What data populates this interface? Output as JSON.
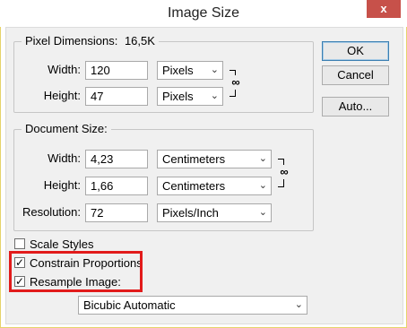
{
  "window": {
    "title": "Image Size",
    "close_glyph": "x"
  },
  "buttons": {
    "ok": "OK",
    "cancel": "Cancel",
    "auto": "Auto..."
  },
  "pixel_dimensions": {
    "legend": "Pixel Dimensions:",
    "size": "16,5K",
    "width": {
      "label": "Width:",
      "value": "120",
      "unit": "Pixels"
    },
    "height": {
      "label": "Height:",
      "value": "47",
      "unit": "Pixels"
    }
  },
  "document_size": {
    "legend": "Document Size:",
    "width": {
      "label": "Width:",
      "value": "4,23",
      "unit": "Centimeters"
    },
    "height": {
      "label": "Height:",
      "value": "1,66",
      "unit": "Centimeters"
    },
    "resolution": {
      "label": "Resolution:",
      "value": "72",
      "unit": "Pixels/Inch"
    }
  },
  "options": {
    "scale_styles": {
      "label": "Scale Styles",
      "checked": false
    },
    "constrain_proportions": {
      "label": "Constrain Proportions",
      "checked": true
    },
    "resample_image": {
      "label": "Resample Image:",
      "checked": true
    },
    "resample_method": "Bicubic Automatic"
  },
  "icons": {
    "link": "chain-link-icon",
    "dropdown": "chevron-down-icon"
  },
  "colors": {
    "highlight": "#e21b1b",
    "close_button": "#c7514a"
  }
}
